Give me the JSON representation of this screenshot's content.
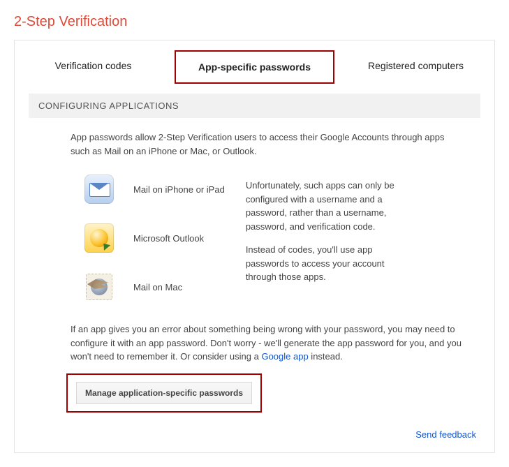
{
  "page_title": "2-Step Verification",
  "tabs": [
    {
      "label": "Verification codes",
      "active": false
    },
    {
      "label": "App-specific passwords",
      "active": true
    },
    {
      "label": "Registered computers",
      "active": false
    }
  ],
  "section_header": "CONFIGURING APPLICATIONS",
  "intro": "App passwords allow 2-Step Verification users to access their Google Accounts through apps such as Mail on an iPhone or Mac, or Outlook.",
  "apps": [
    {
      "label": "Mail on iPhone or iPad"
    },
    {
      "label": "Microsoft Outlook"
    },
    {
      "label": "Mail on Mac"
    }
  ],
  "side_paragraphs": [
    "Unfortunately, such apps can only be configured with a username and a password, rather than a username, password, and verification code.",
    "Instead of codes, you'll use app passwords to access your account through those apps."
  ],
  "footer_text_pre": "If an app gives you an error about something being wrong with your password, you may need to configure it with an app password. Don't worry - we'll generate the app password for you, and you won't need to remember it. Or consider using a ",
  "footer_link": "Google app",
  "footer_text_post": " instead.",
  "manage_button": "Manage application-specific passwords",
  "feedback_link": "Send feedback"
}
